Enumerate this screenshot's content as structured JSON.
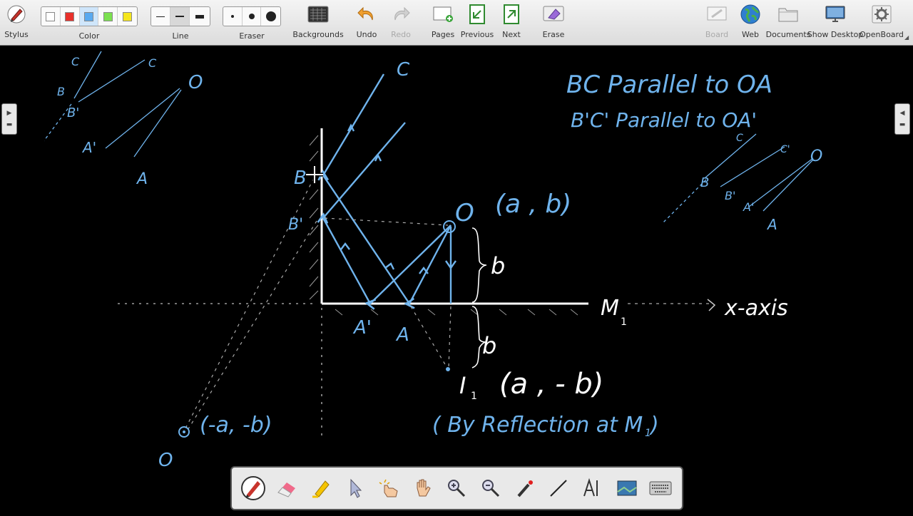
{
  "toolbar": {
    "stylus": "Stylus",
    "color": "Color",
    "line": "Line",
    "eraser": "Eraser",
    "backgrounds": "Backgrounds",
    "undo": "Undo",
    "redo": "Redo",
    "pages": "Pages",
    "previous": "Previous",
    "next": "Next",
    "erase": "Erase",
    "board": "Board",
    "web": "Web",
    "documents": "Documents",
    "show_desktop": "Show Desktop",
    "openboard": "OpenBoard"
  },
  "colors": {
    "swatches": [
      "#ffffff",
      "#e8302a",
      "#5aaaf0",
      "#7ce050",
      "#f5e61e"
    ],
    "ink": "#6fb3ec",
    "chalk": "#ffffff",
    "board": "#000000"
  },
  "board": {
    "top_left_sketch": {
      "c1": "C",
      "c2": "C",
      "o": "O",
      "b": "B",
      "b_prime": "B'",
      "a_prime": "A'",
      "a": "A"
    },
    "right_note_line1": "BC  Parallel to OA",
    "right_note_line2": "B'C'  Parallel to OA'",
    "right_sketch": {
      "c1": "C",
      "c2": "C'",
      "o": "O",
      "b": "B",
      "b_prime": "B'",
      "a_prime": "A'",
      "a": "A"
    },
    "label_c": "C",
    "label_b": "B",
    "label_b_prime": "B'",
    "label_o": "O",
    "coord_o": "(a , b)",
    "brace_b_upper": "b",
    "mirror_label": "M",
    "mirror_sub": "1",
    "x_axis_label": "x-axis",
    "label_a_prime": "A'",
    "label_a": "A",
    "brace_b_lower": "b",
    "image_label": "I",
    "image_sub": "1",
    "coord_image": "(a , - b)",
    "reflection_note": "( By Reflection at M",
    "reflection_sub": "1",
    "reflection_close": ")",
    "coord_far": "(-a, -b)",
    "label_far_o": "O"
  },
  "dock": {
    "tools": [
      "pen-tool",
      "eraser-tool",
      "marker-tool",
      "selector-tool",
      "interact-tool",
      "hand-tool",
      "zoom-in-tool",
      "zoom-out-tool",
      "laser-pointer-tool",
      "line-tool",
      "text-tool",
      "capture-tool",
      "virtual-keyboard-tool"
    ]
  }
}
